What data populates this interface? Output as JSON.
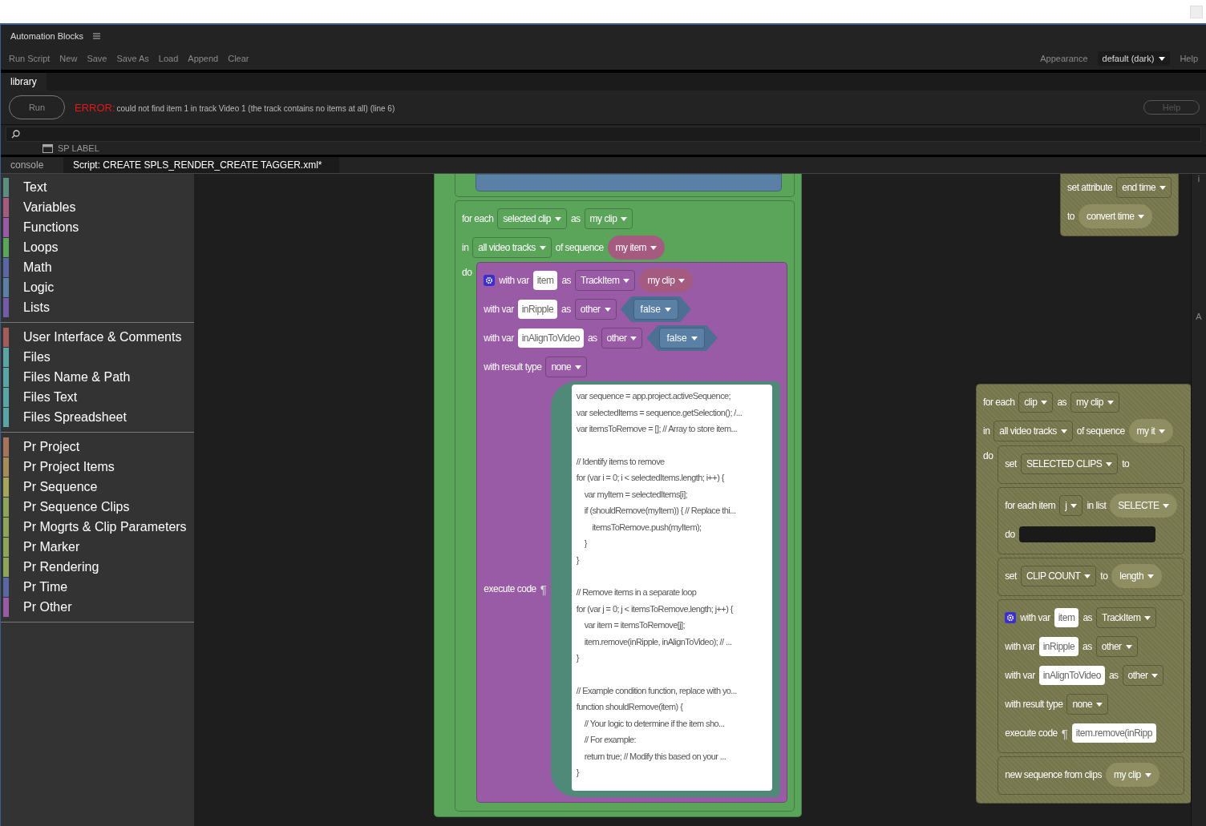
{
  "window": {
    "title": "Automation Blocks"
  },
  "menu": {
    "items": [
      "Run Script",
      "New",
      "Save",
      "Save As",
      "Load",
      "Append",
      "Clear"
    ],
    "appearance_label": "Appearance",
    "appearance_value": "default (dark)",
    "help": "Help"
  },
  "top_tabs": [
    {
      "label": "library",
      "selected": true
    }
  ],
  "run_bar": {
    "run": "Run",
    "error_label": "ERROR:",
    "error_message": "could not find item 1 in track Video 1 (the track contains no items at all) (line 6)",
    "help": {
      "label": "Help",
      "disabled": true
    }
  },
  "sp_label": "SP LABEL",
  "editor_tabs": [
    {
      "label": "console",
      "selected": false
    },
    {
      "label": "Script: CREATE SPLS_RENDER_CREATE TAGGER.xml*",
      "selected": true
    }
  ],
  "categories": [
    [
      {
        "label": "Text",
        "color": "#5b8f80"
      },
      {
        "label": "Variables",
        "color": "#a55b80"
      },
      {
        "label": "Functions",
        "color": "#995ba5"
      },
      {
        "label": "Loops",
        "color": "#5ba55b"
      },
      {
        "label": "Math",
        "color": "#5b67a5"
      },
      {
        "label": "Logic",
        "color": "#5b80a5"
      },
      {
        "label": "Lists",
        "color": "#745ba5"
      }
    ],
    [
      {
        "label": "User Interface & Comments",
        "color": "#a55b5b"
      },
      {
        "label": "Files",
        "color": "#5ba5a5"
      },
      {
        "label": "Files Name & Path",
        "color": "#5ba5a5"
      },
      {
        "label": "Files Text",
        "color": "#5ba5a5"
      },
      {
        "label": "Files Spreadsheet",
        "color": "#5ba5a5"
      }
    ],
    [
      {
        "label": "Pr Project",
        "color": "#a5745b"
      },
      {
        "label": "Pr Project Items",
        "color": "#a58c5b"
      },
      {
        "label": "Pr Sequence",
        "color": "#a5a55b"
      },
      {
        "label": "Pr Sequence Clips",
        "color": "#8ca55b"
      },
      {
        "label": "Pr Mogrts & Clip Parameters",
        "color": "#8ca55b"
      },
      {
        "label": "Pr Marker",
        "color": "#8ca55b"
      },
      {
        "label": "Pr Rendering",
        "color": "#8ca55b"
      },
      {
        "label": "Pr Time",
        "color": "#5b67a5"
      },
      {
        "label": "Pr Other",
        "color": "#995ba5"
      }
    ]
  ],
  "side_labels": [
    "i",
    "A"
  ],
  "blocks": [
    {
      "kind": "loop",
      "disabled": false,
      "rows": [
        {
          "parts": [
            {
              "kind": "statements",
              "blocks": [
                {
                  "kind": "loop",
                  "disabled": false,
                  "rows": [
                    {
                      "parts": [
                        {
                          "kind": "statements",
                          "blocks": [
                            {
                              "kind": "logic",
                              "disabled": false
                            }
                          ]
                        }
                      ]
                    }
                  ]
                },
                {
                  "kind": "loop",
                  "disabled": false,
                  "rows": [
                    {
                      "parts": [
                        {
                          "kind": "label",
                          "text": "for each"
                        },
                        {
                          "kind": "dropdown",
                          "text": "selected clip"
                        },
                        {
                          "kind": "label",
                          "text": "as"
                        },
                        {
                          "kind": "dropdown",
                          "text": "my clip"
                        }
                      ]
                    },
                    {
                      "parts": [
                        {
                          "kind": "label",
                          "text": "in"
                        },
                        {
                          "kind": "dropdown",
                          "text": "all video tracks"
                        },
                        {
                          "kind": "label",
                          "text": "of sequence"
                        },
                        {
                          "kind": "round",
                          "text": "my item"
                        }
                      ]
                    },
                    {
                      "parts": [
                        {
                          "kind": "label",
                          "text": "do"
                        },
                        {
                          "kind": "statements",
                          "blocks": [
                            {
                              "kind": "with_var",
                              "disabled": false,
                              "rows": [
                                {
                                  "parts": [
                                    {
                                      "kind": "gear"
                                    },
                                    {
                                      "kind": "label",
                                      "text": "with var"
                                    },
                                    {
                                      "kind": "input",
                                      "text": "item"
                                    },
                                    {
                                      "kind": "label",
                                      "text": "as"
                                    },
                                    {
                                      "kind": "dropdown",
                                      "text": "TrackItem"
                                    },
                                    {
                                      "kind": "round",
                                      "text": "my clip"
                                    }
                                  ]
                                },
                                {
                                  "parts": [
                                    {
                                      "kind": "label",
                                      "text": "with var"
                                    },
                                    {
                                      "kind": "input",
                                      "text": "inRipple"
                                    },
                                    {
                                      "kind": "label",
                                      "text": "as"
                                    },
                                    {
                                      "kind": "dropdown",
                                      "text": "other"
                                    },
                                    {
                                      "kind": "hex",
                                      "text": "false"
                                    }
                                  ]
                                },
                                {
                                  "parts": [
                                    {
                                      "kind": "label",
                                      "text": "with var"
                                    },
                                    {
                                      "kind": "input",
                                      "text": "inAlignToVideo"
                                    },
                                    {
                                      "kind": "label",
                                      "text": "as"
                                    },
                                    {
                                      "kind": "dropdown",
                                      "text": "other"
                                    },
                                    {
                                      "kind": "hex",
                                      "text": "false"
                                    }
                                  ]
                                },
                                {
                                  "parts": [
                                    {
                                      "kind": "label",
                                      "text": "with result type"
                                    },
                                    {
                                      "kind": "dropdown",
                                      "text": "none"
                                    }
                                  ]
                                },
                                {
                                  "parts": [
                                    {
                                      "kind": "label",
                                      "text": "execute code"
                                    },
                                    {
                                      "kind": "pilcrow",
                                      "text": "¶"
                                    },
                                    {
                                      "kind": "code",
                                      "paragraphs": [
                                        [
                                          "var sequence = app.project.activeSequence;",
                                          "var selectedItems = sequence.getSelection(); /...",
                                          "var itemsToRemove = []; // Array to store item..."
                                        ],
                                        [
                                          "// Identify items to remove",
                                          "for (var i = 0; i < selectedItems.length; i++) {",
                                          "    var myItem = selectedItems[i];",
                                          "    if (shouldRemove(myItem)) { // Replace thi...",
                                          "        itemsToRemove.push(myItem);",
                                          "    }",
                                          "}"
                                        ],
                                        [
                                          "// Remove items in a separate loop",
                                          "for (var j = 0; j < itemsToRemove.length; j++) {",
                                          "    var item = itemsToRemove[j];",
                                          "    item.remove(inRipple, inAlignToVideo); // ...",
                                          "}"
                                        ],
                                        [
                                          "// Example condition function, replace with yo...",
                                          "function shouldRemove(item) {",
                                          "    // Your logic to determine if the item sho...",
                                          "    // For example:",
                                          "    return true; // Modify this based on your ...",
                                          "}"
                                        ]
                                      ]
                                    }
                                  ]
                                }
                              ]
                            }
                          ]
                        }
                      ]
                    }
                  ]
                }
              ]
            }
          ]
        }
      ]
    },
    {
      "kind": "action",
      "disabled": true,
      "rows": [
        {
          "parts": [
            {
              "kind": "label",
              "text": "set attribute"
            },
            {
              "kind": "dropdown",
              "text": "end time"
            }
          ]
        },
        {
          "parts": [
            {
              "kind": "label",
              "text": "to"
            },
            {
              "kind": "round",
              "text": "convert time"
            }
          ]
        }
      ]
    },
    {
      "kind": "loop",
      "disabled": true,
      "rows": [
        {
          "parts": [
            {
              "kind": "label",
              "text": "for each"
            },
            {
              "kind": "dropdown",
              "text": "clip"
            },
            {
              "kind": "label",
              "text": "as"
            },
            {
              "kind": "dropdown",
              "text": "my clip"
            }
          ]
        },
        {
          "parts": [
            {
              "kind": "label",
              "text": "in"
            },
            {
              "kind": "dropdown",
              "text": "all video tracks"
            },
            {
              "kind": "label",
              "text": "of sequence"
            },
            {
              "kind": "round",
              "text": "my it"
            }
          ]
        },
        {
          "parts": [
            {
              "kind": "label",
              "text": "do"
            },
            {
              "kind": "statements",
              "blocks": [
                {
                  "kind": "action",
                  "rows": [
                    {
                      "parts": [
                        {
                          "kind": "label",
                          "text": "set"
                        },
                        {
                          "kind": "dropdown",
                          "text": "SELECTED CLIPS"
                        },
                        {
                          "kind": "label",
                          "text": "to"
                        }
                      ]
                    }
                  ]
                },
                {
                  "kind": "loop",
                  "rows": [
                    {
                      "parts": [
                        {
                          "kind": "label",
                          "text": "for each item"
                        },
                        {
                          "kind": "dropdown",
                          "text": "j"
                        },
                        {
                          "kind": "label",
                          "text": "in list"
                        },
                        {
                          "kind": "round",
                          "text": "SELECTE"
                        }
                      ]
                    },
                    {
                      "parts": [
                        {
                          "kind": "label",
                          "text": "do"
                        },
                        {
                          "kind": "slot"
                        }
                      ]
                    }
                  ]
                },
                {
                  "kind": "action",
                  "rows": [
                    {
                      "parts": [
                        {
                          "kind": "label",
                          "text": "set"
                        },
                        {
                          "kind": "dropdown",
                          "text": "CLIP COUNT"
                        },
                        {
                          "kind": "label",
                          "text": "to"
                        },
                        {
                          "kind": "round",
                          "text": "length"
                        }
                      ]
                    }
                  ]
                },
                {
                  "kind": "with_var",
                  "rows": [
                    {
                      "parts": [
                        {
                          "kind": "gear"
                        },
                        {
                          "kind": "label",
                          "text": "with var"
                        },
                        {
                          "kind": "input",
                          "text": "item"
                        },
                        {
                          "kind": "label",
                          "text": "as"
                        },
                        {
                          "kind": "dropdown",
                          "text": "TrackItem"
                        }
                      ]
                    },
                    {
                      "parts": [
                        {
                          "kind": "label",
                          "text": "with var"
                        },
                        {
                          "kind": "input",
                          "text": "inRipple"
                        },
                        {
                          "kind": "label",
                          "text": "as"
                        },
                        {
                          "kind": "dropdown",
                          "text": "other"
                        }
                      ]
                    },
                    {
                      "parts": [
                        {
                          "kind": "label",
                          "text": "with var"
                        },
                        {
                          "kind": "input",
                          "text": "inAlignToVideo"
                        },
                        {
                          "kind": "label",
                          "text": "as"
                        },
                        {
                          "kind": "dropdown",
                          "text": "other"
                        }
                      ]
                    },
                    {
                      "parts": [
                        {
                          "kind": "label",
                          "text": "with result type"
                        },
                        {
                          "kind": "dropdown",
                          "text": "none"
                        }
                      ]
                    },
                    {
                      "parts": [
                        {
                          "kind": "label",
                          "text": "execute code"
                        },
                        {
                          "kind": "pilcrow",
                          "text": "¶"
                        },
                        {
                          "kind": "input",
                          "text": "item.remove(inRipp"
                        }
                      ]
                    }
                  ]
                },
                {
                  "kind": "action",
                  "rows": [
                    {
                      "parts": [
                        {
                          "kind": "label",
                          "text": "new sequence from clips"
                        },
                        {
                          "kind": "round",
                          "text": "my clip"
                        }
                      ]
                    }
                  ]
                }
              ]
            }
          ]
        }
      ]
    }
  ]
}
